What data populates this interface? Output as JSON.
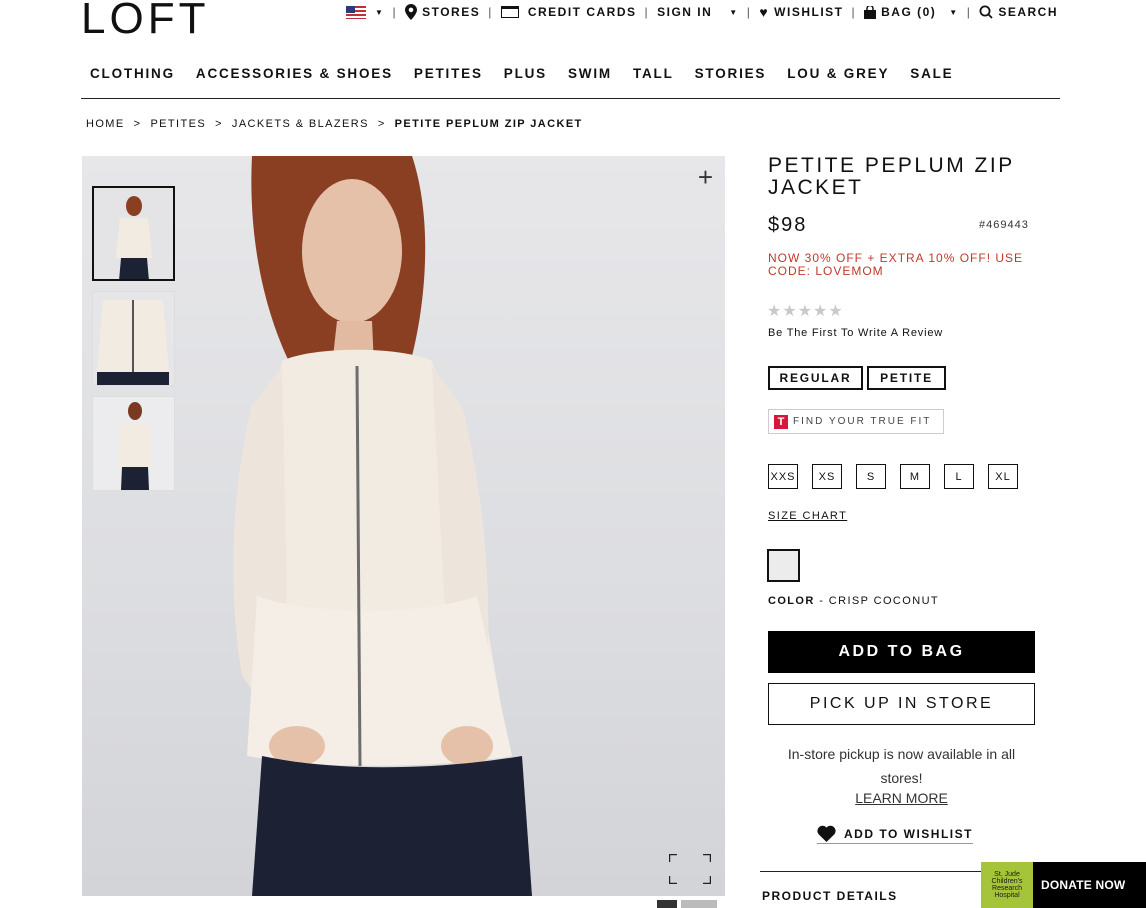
{
  "brand": {
    "logo": "LOFT"
  },
  "utility": {
    "stores": "STORES",
    "credit_cards": "CREDIT CARDS",
    "sign_in": "SIGN IN",
    "wishlist": "WISHLIST",
    "bag": "BAG (0)",
    "search": "SEARCH"
  },
  "nav": [
    "CLOTHING",
    "ACCESSORIES & SHOES",
    "PETITES",
    "PLUS",
    "SWIM",
    "TALL",
    "STORIES",
    "LOU & GREY",
    "SALE"
  ],
  "breadcrumb": [
    "HOME",
    ">",
    "PETITES",
    ">",
    "JACKETS & BLAZERS",
    ">",
    "PETITE PEPLUM ZIP JACKET"
  ],
  "product": {
    "title": "PETITE PEPLUM ZIP JACKET",
    "price": "$98",
    "sku": "#469443",
    "promo": "NOW 30% OFF + EXTRA 10% OFF! USE CODE: LOVEMOM",
    "stars": "★★★★★",
    "rating": 0,
    "review_cta": "Be The First To Write A Review",
    "fit_options": [
      "REGULAR",
      "PETITE"
    ],
    "fit_selected": "PETITE",
    "true_fit": "FIND YOUR TRUE FIT",
    "true_fit_logo": "T",
    "sizes": [
      "XXS",
      "XS",
      "S",
      "M",
      "L",
      "XL"
    ],
    "size_chart": "SIZE CHART",
    "color_label": "COLOR",
    "color_sep": "-",
    "color_name": "CRISP COCONUT",
    "add_to_bag": "ADD TO BAG",
    "pick_up": "PICK UP IN STORE",
    "pickup_info": "In-store pickup is now available in all stores!",
    "learn_more": "LEARN MORE",
    "add_to_wishlist": "ADD TO WISHLIST",
    "details": "PRODUCT DETAILS"
  },
  "gallery": {
    "plus": "+"
  },
  "donate": {
    "label": "DONATE NOW",
    "badge": "St. Jude Children's Research Hospital"
  },
  "colors": {
    "promo": "#c0392b",
    "swatch": "#ececec",
    "truefit": "#d6163b",
    "donate_badge": "#a6c43a"
  }
}
